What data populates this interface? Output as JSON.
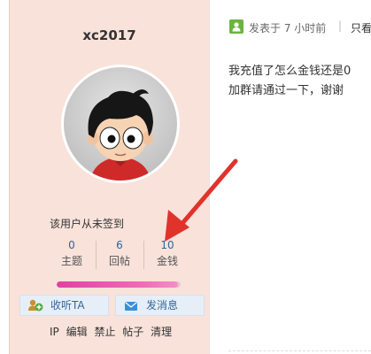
{
  "profile": {
    "username": "xc2017",
    "sign_status": "该用户从未签到",
    "stats": [
      {
        "value": "0",
        "label": "主题"
      },
      {
        "value": "6",
        "label": "回帖"
      },
      {
        "value": "10",
        "label": "金钱"
      }
    ],
    "progress_fraction": 0.98,
    "follow_label": "收听TA",
    "message_label": "发消息",
    "admin_links": [
      "IP",
      "编辑",
      "禁止",
      "帖子",
      "清理"
    ]
  },
  "post": {
    "posted_time": "发表于 7 小时前",
    "separator": "|",
    "view_only": "只看",
    "lines": [
      "我充值了怎么金钱还是0",
      "加群请通过一下，谢谢"
    ]
  },
  "colors": {
    "sidebar_bg": "#f8e2da",
    "link_blue": "#336699",
    "arrow_red": "#e0332c",
    "progress_pink": "#e23fa5"
  }
}
